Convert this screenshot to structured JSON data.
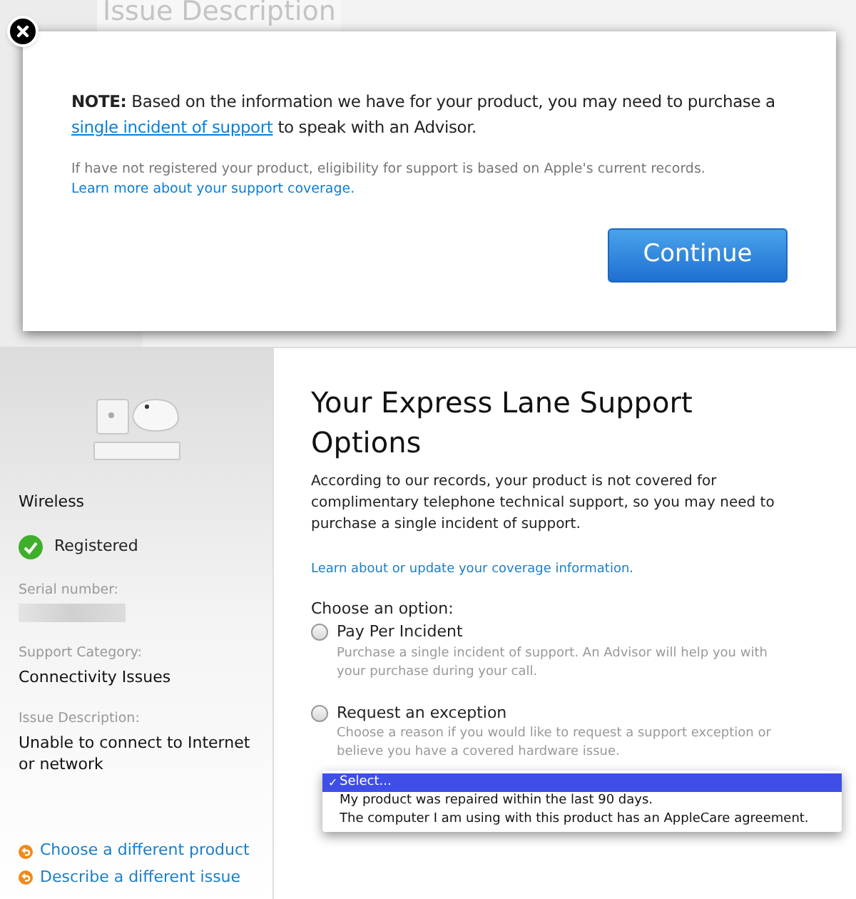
{
  "background": {
    "heading": "Issue Description"
  },
  "modal": {
    "note_label": "NOTE:",
    "note_before": "Based on the information we have for your product, you may need to purchase a",
    "note_link": "single incident of support",
    "note_after": "to speak with an Advisor.",
    "info": "If have not registered your product, eligibility for support is based on Apple's current records.",
    "info_link": "Learn more about your support coverage.",
    "button": "Continue"
  },
  "sidebar": {
    "product": "Wireless",
    "status": "Registered",
    "registered": true,
    "fields": [
      {
        "label": "Serial number:",
        "redacted": true
      },
      {
        "label": "Support Category:",
        "value": "Connectivity Issues"
      },
      {
        "label": "Issue Description:",
        "value": "Unable to connect to Internet or network"
      }
    ],
    "links": [
      "Choose a different product",
      "Describe a different issue"
    ]
  },
  "main": {
    "title": "Your Express Lane Support Options",
    "intro": "According to our records, your product is not covered for complimentary telephone technical support, so you may need to purchase a single incident of support.",
    "coverage_link": "Learn about or update your coverage information.",
    "choose_label": "Choose an option:",
    "options": [
      {
        "label": "Pay Per Incident",
        "description": "Purchase a single incident of support. An Advisor will help you with your purchase during your call.",
        "checked": false
      },
      {
        "label": "Request an exception",
        "description": "Choose a reason if you would like to request a support exception or believe you have a covered hardware issue.",
        "checked": false
      }
    ],
    "dropdown": {
      "check": "✓",
      "items": [
        {
          "label": "Select...",
          "selected": true
        },
        {
          "label": "My product was repaired within the last 90 days.",
          "selected": false
        },
        {
          "label": "The computer I am using with this product has an AppleCare agreement.",
          "selected": false
        }
      ]
    }
  }
}
